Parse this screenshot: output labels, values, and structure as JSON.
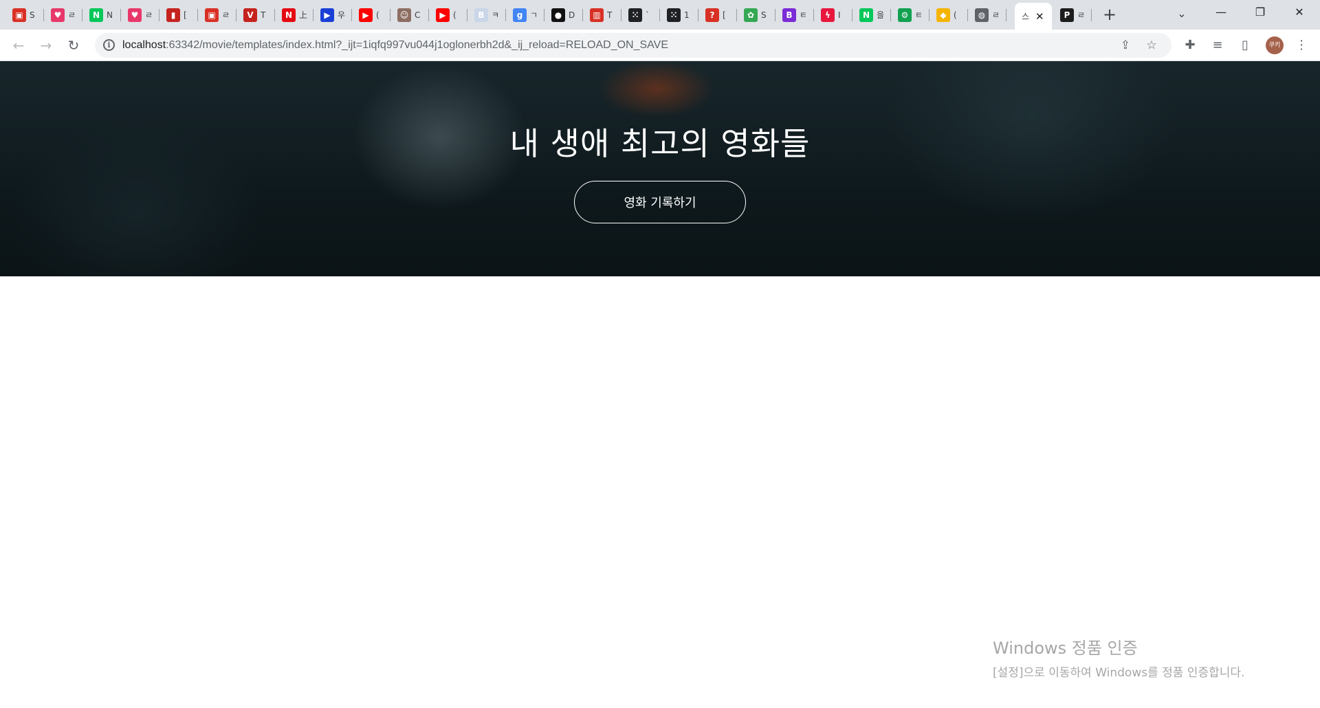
{
  "browser": {
    "tabs": [
      {
        "icon": "red-shield-favicon",
        "glyph": "▣",
        "color": "#d93025",
        "title": "S"
      },
      {
        "icon": "heart-chat-favicon",
        "glyph": "♥",
        "color": "#e8386a",
        "title": "ㄹ"
      },
      {
        "icon": "naver-favicon",
        "glyph": "N",
        "color": "#03c75a",
        "title": "N"
      },
      {
        "icon": "heart-chat-favicon",
        "glyph": "♥",
        "color": "#e8386a",
        "title": "ㄹ"
      },
      {
        "icon": "red-book-favicon",
        "glyph": "▮",
        "color": "#c5221f",
        "title": "["
      },
      {
        "icon": "red-shield-favicon",
        "glyph": "▣",
        "color": "#d93025",
        "title": "ㄹ"
      },
      {
        "icon": "v-logo-favicon",
        "glyph": "V",
        "color": "#c5221f",
        "title": "T"
      },
      {
        "icon": "netflix-favicon",
        "glyph": "N",
        "color": "#e50914",
        "title": "上"
      },
      {
        "icon": "play-favicon",
        "glyph": "▶",
        "color": "#1a3fd6",
        "title": "우"
      },
      {
        "icon": "youtube-favicon",
        "glyph": "▶",
        "color": "#ff0000",
        "title": "("
      },
      {
        "icon": "portrait-favicon",
        "glyph": "☺",
        "color": "#8d6e63",
        "title": "C"
      },
      {
        "icon": "youtube-favicon",
        "glyph": "▶",
        "color": "#ff0000",
        "title": "("
      },
      {
        "icon": "blank-page-favicon",
        "glyph": "B",
        "color": "#c9d6e8",
        "title": "ㅋ"
      },
      {
        "icon": "g-logo-favicon",
        "glyph": "g",
        "color": "#4285f4",
        "title": "ㄱ"
      },
      {
        "icon": "circle-logo-favicon",
        "glyph": "●",
        "color": "#111111",
        "title": "D"
      },
      {
        "icon": "bars-logo-favicon",
        "glyph": "▥",
        "color": "#d93025",
        "title": "T"
      },
      {
        "icon": "dots-favicon",
        "glyph": "⁙",
        "color": "#202124",
        "title": "`"
      },
      {
        "icon": "dots-favicon",
        "glyph": "⁙",
        "color": "#202124",
        "title": "1"
      },
      {
        "icon": "question-favicon",
        "glyph": "?",
        "color": "#d93025",
        "title": "["
      },
      {
        "icon": "colorful-logo-favicon",
        "glyph": "✿",
        "color": "#34a853",
        "title": "S"
      },
      {
        "icon": "b-logo-favicon",
        "glyph": "B",
        "color": "#7b2cd6",
        "title": "ㅌ"
      },
      {
        "icon": "bolt-favicon",
        "glyph": "ϟ",
        "color": "#e8173e",
        "title": "I"
      },
      {
        "icon": "naver-favicon",
        "glyph": "N",
        "color": "#03c75a",
        "title": "을"
      },
      {
        "icon": "green-gear-favicon",
        "glyph": "⚙",
        "color": "#12a150",
        "title": "ㅌ"
      },
      {
        "icon": "box-favicon",
        "glyph": "◆",
        "color": "#f4b400",
        "title": "("
      },
      {
        "icon": "globe-favicon",
        "glyph": "◍",
        "color": "#5f6368",
        "title": "ㄹ"
      },
      {
        "icon": "pycharm-favicon",
        "glyph": "P",
        "color": "#1d1d1d",
        "title": "ㄹ"
      }
    ],
    "active_tab": {
      "title": "스"
    },
    "url_host": "localhost",
    "url_rest": ":63342/movie/templates/index.html?_ijt=1iqfq997vu044j1oglonerbh2d&_ij_reload=RELOAD_ON_SAVE",
    "profile_initials": "쿠키"
  },
  "page": {
    "hero_title": "내 생애 최고의 영화들",
    "hero_button": "영화 기록하기"
  },
  "watermark": {
    "line1": "Windows 정품 인증",
    "line2": "[설정]으로 이동하여 Windows를 정품 인증합니다."
  }
}
